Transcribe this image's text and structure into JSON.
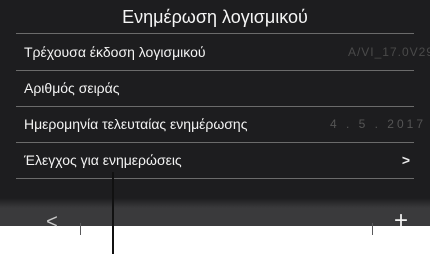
{
  "header": {
    "title": "Ενημέρωση λογισμικού"
  },
  "rows": [
    {
      "label": "Τρέχουσα έκδοση λογισμικού",
      "value": "A/VI_17.0V29"
    },
    {
      "label": "Αριθμός σειράς",
      "value": ""
    },
    {
      "label": "Ημερομηνία τελευταίας ενημέρωσης",
      "value": "4 . 5 . 2017"
    },
    {
      "label": "Έλεγχος για ενημερώσεις",
      "value": ">"
    }
  ],
  "footer": {
    "back_icon": "<",
    "add_icon": "+"
  }
}
